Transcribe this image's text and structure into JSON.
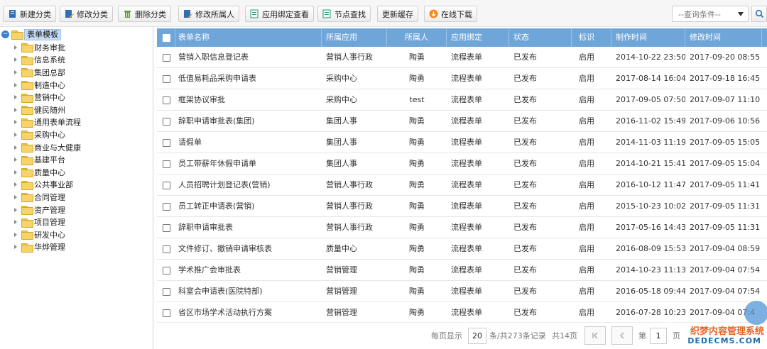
{
  "toolbar": {
    "buttons": [
      {
        "label": "新建分类",
        "icon": "new-category-icon",
        "color": "#2f6fb5"
      },
      {
        "label": "修改分类",
        "icon": "edit-category-icon",
        "color": "#2f6fb5"
      },
      {
        "label": "删除分类",
        "icon": "trash-icon",
        "color": "#5aa33a"
      },
      {
        "label": "修改所属人",
        "icon": "edit-owner-icon",
        "color": "#2f6fb5"
      },
      {
        "label": "应用绑定查看",
        "icon": "binding-view-icon",
        "color": "#2f8f6f"
      },
      {
        "label": "节点查找",
        "icon": "node-search-icon",
        "color": "#2f8f6f"
      },
      {
        "label": "更新缓存",
        "icon": "",
        "color": ""
      },
      {
        "label": "在线下载",
        "icon": "cloud-download-icon",
        "color": "#f08a1c"
      }
    ],
    "query_placeholder": "--查询条件--",
    "search_icon": "search-icon"
  },
  "tree": {
    "root": "表单模板",
    "items": [
      "财务审批",
      "信息系统",
      "集团总部",
      "制造中心",
      "营销中心",
      "健民随州",
      "通用表单流程",
      "采购中心",
      "商业与大健康",
      "基建平台",
      "质量中心",
      "公共事业部",
      "合同管理",
      "资产管理",
      "项目管理",
      "研发中心",
      "华烨管理"
    ]
  },
  "grid": {
    "headers": [
      "表单名称",
      "所属应用",
      "所属人",
      "应用绑定",
      "状态",
      "标识",
      "制作时间",
      "修改时间"
    ],
    "rows": [
      [
        "营销入职信息登记表",
        "营销人事行政",
        "陶勇",
        "流程表单",
        "已发布",
        "启用",
        "2014-10-22 23:50",
        "2017-09-20 08:55"
      ],
      [
        "低值易耗品采购申请表",
        "采购中心",
        "陶勇",
        "流程表单",
        "已发布",
        "启用",
        "2017-08-14 16:04",
        "2017-09-18 16:45"
      ],
      [
        "框架协议审批",
        "采购中心",
        "test",
        "流程表单",
        "已发布",
        "启用",
        "2017-09-05 07:50",
        "2017-09-07 11:10"
      ],
      [
        "辞职申请审批表(集团)",
        "集团人事",
        "陶勇",
        "流程表单",
        "已发布",
        "启用",
        "2016-11-02 15:49",
        "2017-09-06 10:56"
      ],
      [
        "请假单",
        "集团人事",
        "陶勇",
        "流程表单",
        "已发布",
        "启用",
        "2014-11-03 11:19",
        "2017-09-05 15:05"
      ],
      [
        "员工带薪年休假申请单",
        "集团人事",
        "陶勇",
        "流程表单",
        "已发布",
        "启用",
        "2014-10-21 15:41",
        "2017-09-05 15:04"
      ],
      [
        "人员招聘计划登记表(营销)",
        "营销人事行政",
        "陶勇",
        "流程表单",
        "已发布",
        "启用",
        "2016-10-12 11:47",
        "2017-09-05 11:41"
      ],
      [
        "员工转正申请表(营销)",
        "营销人事行政",
        "陶勇",
        "流程表单",
        "已发布",
        "启用",
        "2015-10-23 10:02",
        "2017-09-05 11:31"
      ],
      [
        "辞职申请审批表",
        "营销人事行政",
        "陶勇",
        "流程表单",
        "已发布",
        "启用",
        "2017-05-16 14:43",
        "2017-09-05 11:31"
      ],
      [
        "文件修订、撤销申请审核表",
        "质量中心",
        "陶勇",
        "流程表单",
        "已发布",
        "启用",
        "2016-08-09 15:53",
        "2017-09-04 08:59"
      ],
      [
        "学术推广会审批表",
        "营销管理",
        "陶勇",
        "流程表单",
        "已发布",
        "启用",
        "2014-10-23 11:13",
        "2017-09-04 07:54"
      ],
      [
        "科室会申请表(医院特部)",
        "营销管理",
        "陶勇",
        "流程表单",
        "已发布",
        "启用",
        "2016-05-18 09:44",
        "2017-09-04 07:54"
      ],
      [
        "省区市场学术活动执行方案",
        "营销管理",
        "陶勇",
        "流程表单",
        "已发布",
        "启用",
        "2016-07-28 10:23",
        "2017-09-04 07:4"
      ]
    ]
  },
  "pager": {
    "per_page_label": "每页显示",
    "per_page": "20",
    "records_text": "条/共273条记录",
    "pages_text": "共14页",
    "page_label": "第",
    "page": "1",
    "page_suffix": "页"
  },
  "watermark": {
    "cn": "织梦内容管理系统",
    "en": "DEDECMS.COM"
  }
}
